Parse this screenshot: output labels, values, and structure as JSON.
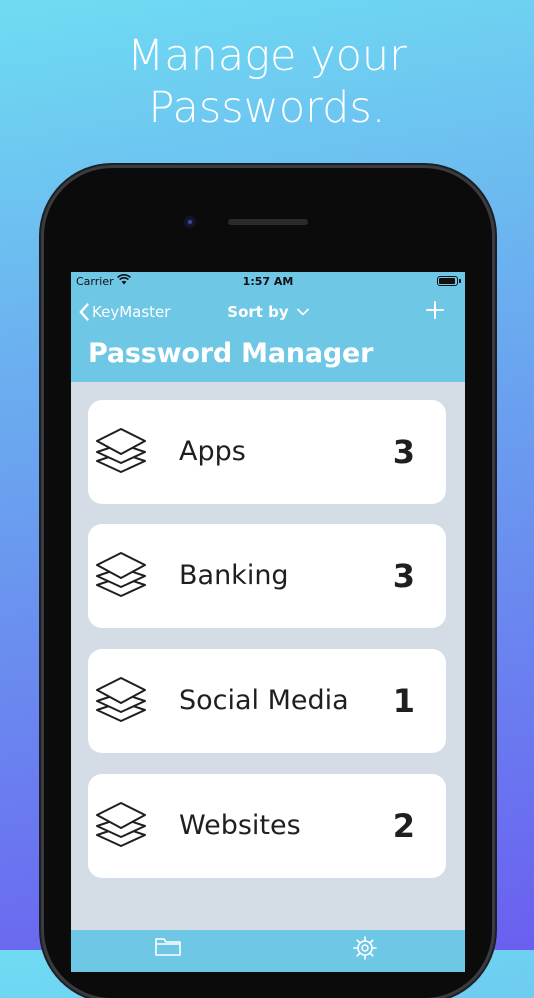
{
  "promo": {
    "headline_line1": "Manage your",
    "headline_line2": "Passwords."
  },
  "status_bar": {
    "carrier": "Carrier",
    "time": "1:57 AM"
  },
  "nav_bar": {
    "back_label": "KeyMaster",
    "sort_label": "Sort by",
    "add_icon": "plus-icon",
    "title": "Password Manager"
  },
  "categories": [
    {
      "label": "Apps",
      "count": "3",
      "icon": "layers-icon"
    },
    {
      "label": "Banking",
      "count": "3",
      "icon": "layers-icon"
    },
    {
      "label": "Social Media",
      "count": "1",
      "icon": "layers-icon"
    },
    {
      "label": "Websites",
      "count": "2",
      "icon": "layers-icon"
    }
  ],
  "tab_bar": {
    "tabs": [
      {
        "icon": "folder-icon"
      },
      {
        "icon": "gear-icon"
      }
    ]
  },
  "colors": {
    "nav_background": "#6fc7e6",
    "list_background": "#d4dde6",
    "card_background": "#ffffff",
    "text_dark": "#1f1f1f"
  }
}
